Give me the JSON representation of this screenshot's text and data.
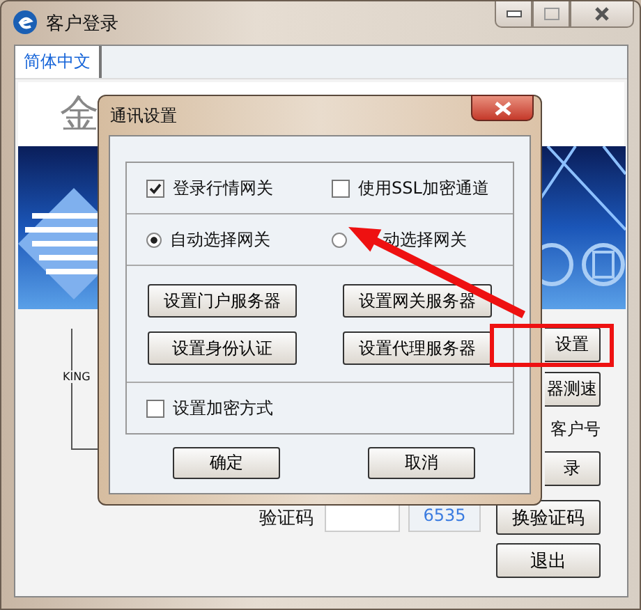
{
  "window": {
    "title": "客户登录"
  },
  "tabs": [
    {
      "label": "简体中文",
      "selected": true
    }
  ],
  "heading": "金",
  "brand": "KING",
  "side_buttons": [
    {
      "kind": "button",
      "label": "设置"
    },
    {
      "kind": "button",
      "label": "器测速"
    },
    {
      "kind": "text",
      "label": "客户号"
    },
    {
      "kind": "button",
      "label": "录"
    }
  ],
  "verify": {
    "label": "验证码",
    "code": "6535",
    "button": "换验证码"
  },
  "exit_button": "退出",
  "dialog": {
    "title": "通讯设置",
    "options": [
      {
        "label": "登录行情网关",
        "checked": true
      },
      {
        "label": "使用SSL加密通道",
        "checked": false
      }
    ],
    "gateway_modes": [
      {
        "label": "自动选择网关",
        "selected": true
      },
      {
        "label": "动选择网关",
        "selected": false
      }
    ],
    "server_buttons": [
      "设置门户服务器",
      "设置网关服务器",
      "设置身份认证",
      "设置代理服务器"
    ],
    "encryption": {
      "label": "设置加密方式",
      "checked": false
    },
    "buttons": [
      "确定",
      "取消"
    ]
  }
}
